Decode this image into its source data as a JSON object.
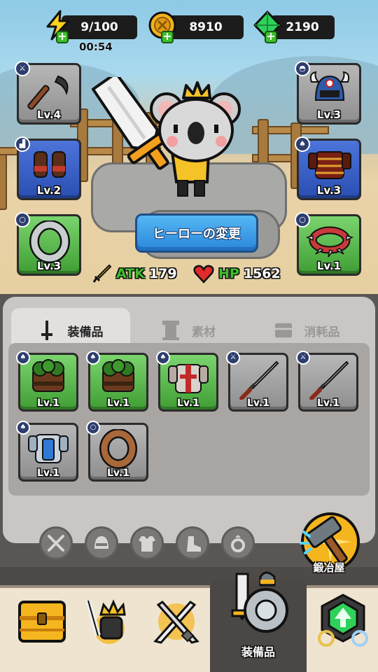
{
  "resources": {
    "energy": "9/100",
    "timer": "00:54",
    "gold": "8910",
    "gems": "2190"
  },
  "equipped": {
    "left": [
      {
        "level": "Lv.4",
        "type": "weapon",
        "rarity": "grey"
      },
      {
        "level": "Lv.2",
        "type": "boots",
        "rarity": "blue"
      },
      {
        "level": "Lv.3",
        "type": "ring",
        "rarity": "green"
      }
    ],
    "right": [
      {
        "level": "Lv.3",
        "type": "helmet",
        "rarity": "grey"
      },
      {
        "level": "Lv.3",
        "type": "armor",
        "rarity": "blue"
      },
      {
        "level": "Lv.1",
        "type": "necklace",
        "rarity": "green"
      }
    ]
  },
  "hero": {
    "change_button": "ヒーローの変更",
    "atk_label": "ATK",
    "atk_value": "179",
    "hp_label": "HP",
    "hp_value": "1562"
  },
  "tabs": [
    {
      "label": "装備品",
      "icon": "sword-icon",
      "active": true
    },
    {
      "label": "素材",
      "icon": "pillar-icon",
      "active": false
    },
    {
      "label": "消耗品",
      "icon": "chest-icon",
      "active": false
    }
  ],
  "inventory": [
    {
      "level": "Lv.1",
      "type": "armor",
      "rarity": "green",
      "icon": "leaf-armor"
    },
    {
      "level": "Lv.1",
      "type": "armor",
      "rarity": "green",
      "icon": "leaf-armor"
    },
    {
      "level": "Lv.1",
      "type": "armor",
      "rarity": "green",
      "icon": "knight-armor"
    },
    {
      "level": "Lv.1",
      "type": "weapon",
      "rarity": "grey",
      "icon": "katana"
    },
    {
      "level": "Lv.1",
      "type": "weapon",
      "rarity": "grey",
      "icon": "katana"
    },
    {
      "level": "Lv.1",
      "type": "armor",
      "rarity": "grey",
      "icon": "blue-armor"
    },
    {
      "level": "Lv.1",
      "type": "ring",
      "rarity": "grey",
      "icon": "wood-ring"
    }
  ],
  "filters": [
    "sword-icon",
    "helmet-icon",
    "armor-icon",
    "boots-icon",
    "ring-icon"
  ],
  "blacksmith": {
    "label": "鍛冶屋"
  },
  "nav": {
    "items": [
      "chest-icon",
      "hero-icon",
      "battle-icon",
      "equipment-icon",
      "upgrade-icon"
    ],
    "active_label": "装備品"
  },
  "colors": {
    "rarity_grey": "#a3a3a3",
    "rarity_blue": "#3560c8",
    "rarity_green": "#5bb84c",
    "button_blue": "#2b86db",
    "atk_text": "#3fbf2d",
    "hp_text": "#3fbf2d"
  }
}
